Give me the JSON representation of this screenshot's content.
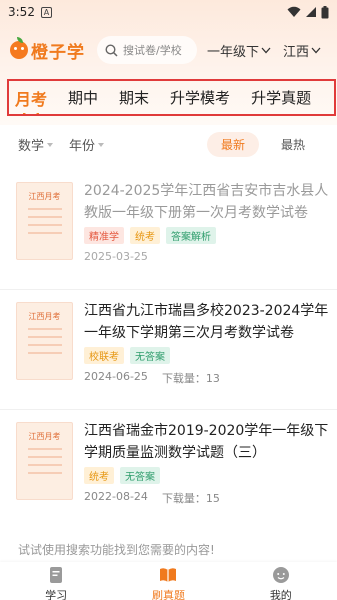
{
  "status_bar": {
    "time": "3:52",
    "notif": "A"
  },
  "header": {
    "logo_text": "橙子学",
    "search_placeholder": "搜试卷/学校",
    "grade": "一年级下",
    "region": "江西"
  },
  "tabs": [
    {
      "label": "月考",
      "active": true
    },
    {
      "label": "期中",
      "active": false
    },
    {
      "label": "期末",
      "active": false
    },
    {
      "label": "升学模考",
      "active": false
    },
    {
      "label": "升学真题",
      "active": false
    }
  ],
  "filters": {
    "subject": "数学",
    "year": "年份",
    "sort_latest": "最新",
    "sort_hot": "最热"
  },
  "list": [
    {
      "thumb_title": "江西月考",
      "title": "2024-2025学年江西省吉安市吉水县人教版一年级下册第一次月考数学试卷",
      "tags": [
        {
          "text": "精准学",
          "color": "red"
        },
        {
          "text": "统考",
          "color": "orange"
        },
        {
          "text": "答案解析",
          "color": "green"
        }
      ],
      "date": "2025-03-25",
      "downloads": ""
    },
    {
      "thumb_title": "江西月考",
      "title": "江西省九江市瑞昌多校2023-2024学年一年级下学期第三次月考数学试卷",
      "tags": [
        {
          "text": "校联考",
          "color": "orange"
        },
        {
          "text": "无答案",
          "color": "green"
        }
      ],
      "date": "2024-06-25",
      "downloads": "下载量：13"
    },
    {
      "thumb_title": "江西月考",
      "title": "江西省瑞金市2019-2020学年一年级下学期质量监测数学试题（三）",
      "tags": [
        {
          "text": "统考",
          "color": "orange"
        },
        {
          "text": "无答案",
          "color": "green"
        }
      ],
      "date": "2022-08-24",
      "downloads": "下载量：15"
    }
  ],
  "hint": "试试使用搜索功能找到您需要的内容!",
  "bottom_nav": [
    {
      "label": "学习",
      "active": false
    },
    {
      "label": "刷真题",
      "active": true
    },
    {
      "label": "我的",
      "active": false
    }
  ]
}
